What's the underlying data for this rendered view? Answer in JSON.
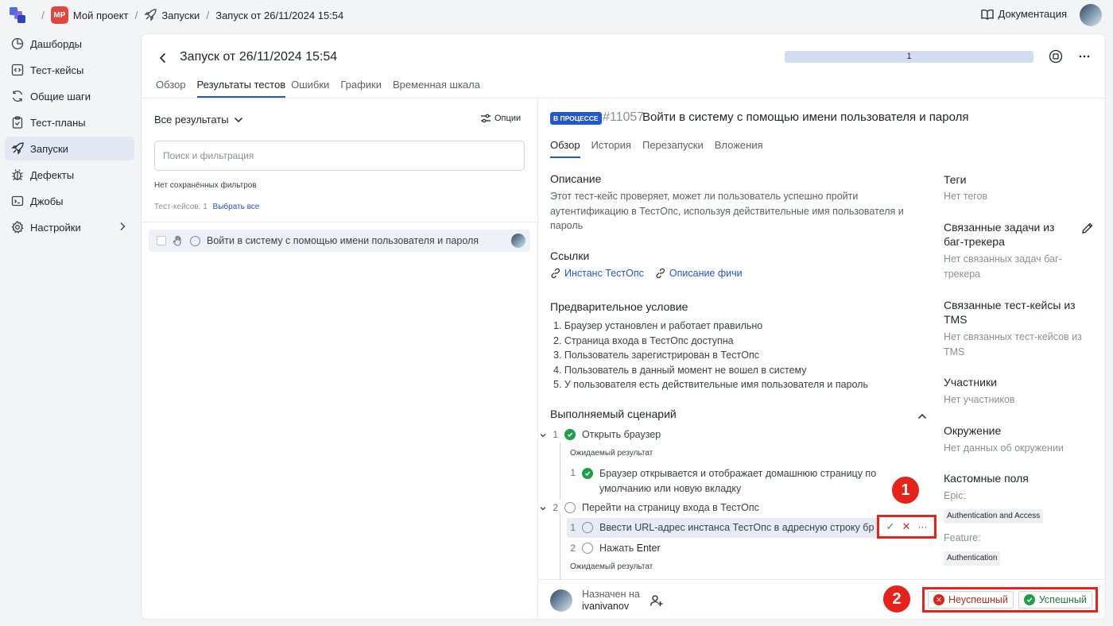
{
  "topbar": {
    "project_badge": "MP",
    "project_name": "Мой проект",
    "section": "Запуски",
    "current": "Запуск от 26/11/2024 15:54",
    "docs": "Документация"
  },
  "sidebar": {
    "items": [
      {
        "label": "Дашборды",
        "icon": "pie-chart-icon"
      },
      {
        "label": "Тест-кейсы",
        "icon": "code-icon"
      },
      {
        "label": "Общие шаги",
        "icon": "refresh-icon"
      },
      {
        "label": "Тест-планы",
        "icon": "clipboard-icon"
      },
      {
        "label": "Запуски",
        "icon": "rocket-icon",
        "active": true
      },
      {
        "label": "Дефекты",
        "icon": "bug-icon"
      },
      {
        "label": "Джобы",
        "icon": "terminal-icon"
      },
      {
        "label": "Настройки",
        "icon": "gear-icon"
      }
    ]
  },
  "launch": {
    "title": "Запуск от 26/11/2024 15:54",
    "progress_label": "1",
    "tabs": [
      "Обзор",
      "Результаты тестов",
      "Ошибки",
      "Графики",
      "Временная шкала"
    ],
    "active_tab": "Результаты тестов"
  },
  "results": {
    "dropdown": "Все результаты",
    "options": "Опции",
    "search_placeholder": "Поиск и фильтрация",
    "no_filters": "Нет сохранённых фильтров",
    "count": "Тест-кейсов: 1",
    "select_all": "Выбрать все",
    "rows": [
      {
        "title": "Войти в систему с помощью имени пользователя и пароля"
      }
    ]
  },
  "detail": {
    "status": "В ПРОЦЕССЕ",
    "id": "#11057",
    "title": "Войти в систему с помощью имени пользователя и пароля",
    "tabs": [
      "Обзор",
      "История",
      "Перезапуски",
      "Вложения"
    ],
    "description_h": "Описание",
    "description": [
      "Этот тест-кейс проверяет, может ли пользователь успешно пройти",
      "аутентификацию в ТестОпс, используя действительные имя пользователя и",
      "пароль"
    ],
    "links_h": "Ссылки",
    "links": [
      "Инстанс ТестОпс",
      "Описание фичи"
    ],
    "precondition_h": "Предварительное условие",
    "preconditions": [
      "1. Браузер установлен и работает правильно",
      "2. Страница входа в ТестОпс доступна",
      "3. Пользователь зарегистрирован в ТестОпс",
      "4. Пользователь в данный момент не вошел в систему",
      "5. У пользователя есть действительные имя пользователя и пароль"
    ],
    "scenario_h": "Выполняемый сценарий",
    "expected_label": "Ожидаемый результат",
    "steps": [
      {
        "num": "1",
        "label": "Открыть браузер"
      },
      {
        "num": "1",
        "label1": "Браузер открывается и отображает домашнюю страницу по",
        "label2": "умолчанию или новую вкладку"
      },
      {
        "num": "2",
        "label": "Перейти на страницу входа в ТестОпс"
      },
      {
        "num": "1",
        "label": "Ввести URL-адрес инстанса ТестОпс в адресную строку бр"
      },
      {
        "num": "2",
        "label": "Нажать",
        "strong": "Enter"
      }
    ]
  },
  "side": {
    "tags_h": "Теги",
    "tags_v": "Нет тегов",
    "issues_h1": "Связанные задачи из",
    "issues_h2": "баг-трекера",
    "issues_v1": "Нет связанных задач баг-",
    "issues_v2": "трекера",
    "tms_h1": "Связанные тест-кейсы из",
    "tms_h2": "TMS",
    "tms_v1": "Нет связанных тест-кейсов из",
    "tms_v2": "TMS",
    "members_h": "Участники",
    "members_v": "Нет участников",
    "env_h": "Окружение",
    "env_v": "Нет данных об окружении",
    "custom_h": "Кастомные поля",
    "epic_label": "Epic:",
    "epic_value": "Authentication and Access",
    "feature_label": "Feature:",
    "feature_value": "Authentication"
  },
  "bottom": {
    "assigned_label": "Назначен на",
    "assignee": "ivanivanov",
    "fail": "Неуспешный",
    "success": "Успешный"
  },
  "callouts": {
    "one": "1",
    "two": "2"
  },
  "colors": {
    "accent": "#2156d6",
    "success": "#1f9d47",
    "fail": "#d9261c",
    "callout": "#e5231b"
  }
}
